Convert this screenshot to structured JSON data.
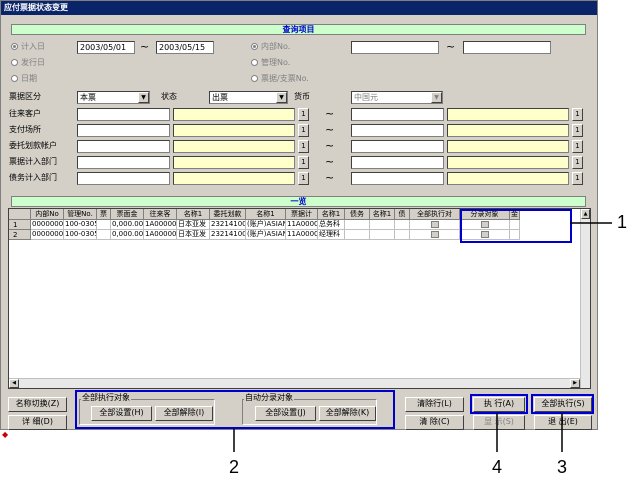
{
  "window": {
    "title": "应付票据状态变更"
  },
  "query": {
    "band": "查询项目",
    "date_radios": [
      {
        "label": "计入日",
        "on": true
      },
      {
        "label": "发行日",
        "on": false
      },
      {
        "label": "日期",
        "on": false
      }
    ],
    "date_from": "2003/05/01",
    "date_tilde": "~",
    "date_to": "2003/05/15",
    "no_radios": [
      {
        "label": "内部No.",
        "on": true
      },
      {
        "label": "管理No.",
        "on": false
      },
      {
        "label": "票据/支票No.",
        "on": false
      }
    ],
    "no_tilde": "~",
    "kubun_label": "票据区分",
    "kubun_value": "本票",
    "status_label": "状态",
    "status_value": "出票",
    "currency_label": "货币",
    "currency_value": "中国元",
    "rows": [
      {
        "label": "往来客户"
      },
      {
        "label": "支付场所"
      },
      {
        "label": "委托划款帐户"
      },
      {
        "label": "票据计入部门"
      },
      {
        "label": "债务计入部门"
      }
    ],
    "lookup_btn": "1",
    "tilde": "~"
  },
  "list": {
    "band": "一览",
    "columns": [
      "内部No",
      "管理No.",
      "票",
      "票面金",
      "往来客",
      "名称1",
      "委托划款",
      "名称1",
      "票据计",
      "名称1",
      "债务",
      "名称1",
      "债",
      "全部执行对",
      "分录对象",
      "金"
    ],
    "rows": [
      {
        "num": "1",
        "cells": [
          "0000000",
          "100-03050",
          "",
          "0,000.00",
          "1A000000",
          "日本亚发",
          "23214100001",
          "(账户)ASIAN",
          "11A00001",
          "总务科",
          "",
          "",
          "",
          "",
          "",
          ""
        ]
      },
      {
        "num": "2",
        "cells": [
          "0000000",
          "100-03050",
          "",
          "0,000.00",
          "1A000000",
          "日本亚发",
          "23214100001",
          "(账户)ASIAN",
          "11A00002",
          "经理科",
          "",
          "",
          "",
          "",
          "",
          ""
        ]
      }
    ]
  },
  "buttons": {
    "name_switch": "名称切换(Z)",
    "detail": "详 细(D)",
    "group1_title": "全部执行对象",
    "g1_set": "全部设置(H)",
    "g1_clear": "全部解除(I)",
    "group2_title": "自动分录对象",
    "g2_set": "全部设置(J)",
    "g2_clear": "全部解除(K)",
    "clear_row": "清除行(L)",
    "clear": "清 除(C)",
    "execute": "执 行(A)",
    "display": "显 示(S)",
    "execute_all": "全部执行(S)",
    "exit": "退 出(E)"
  },
  "callouts": {
    "c1": "1",
    "c2": "2",
    "c3": "3",
    "c4": "4"
  },
  "colors": {
    "band_bg": "#ccffcc",
    "band_text": "#0000cc",
    "highlight": "#0000cc",
    "title_bg": "#0a246a",
    "field_yellow": "#ffffcc"
  }
}
